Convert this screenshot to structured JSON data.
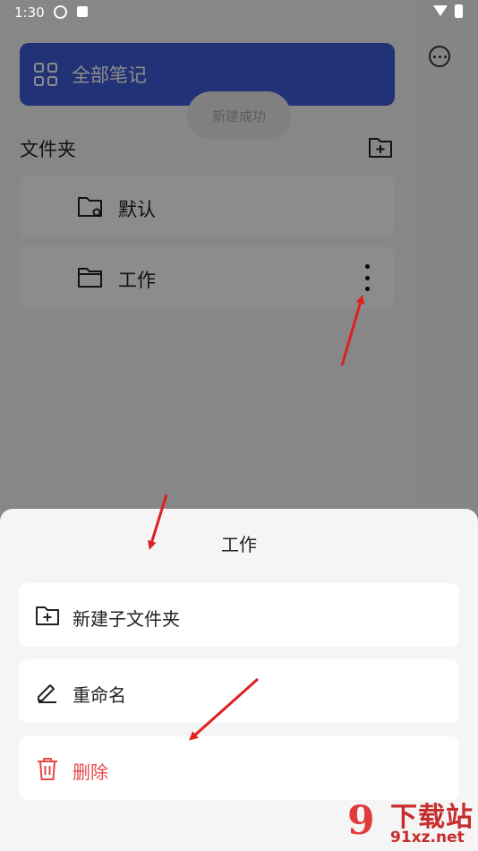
{
  "status_bar": {
    "time": "1:30"
  },
  "drawer": {
    "all_notes_label": "全部笔记",
    "toast": "新建成功",
    "folders_title": "文件夹",
    "folders": [
      {
        "label": "默认"
      },
      {
        "label": "工作"
      }
    ]
  },
  "sheet": {
    "title": "工作",
    "items": [
      {
        "label": "新建子文件夹"
      },
      {
        "label": "重命名"
      },
      {
        "label": "删除"
      }
    ]
  },
  "watermark": {
    "number": "9",
    "brand": "下载站",
    "url": "91xz.net"
  },
  "colors": {
    "accent": "#3f5bd8",
    "danger": "#e54848",
    "arrow": "#e02020"
  },
  "icons": {
    "all_notes": "grid-icon",
    "add_folder": "folder-plus-icon",
    "default_folder": "folder-settings-icon",
    "work_folder": "folder-icon",
    "more": "kebab-icon",
    "new_subfolder": "folder-plus-icon",
    "rename": "pencil-icon",
    "delete": "trash-icon"
  }
}
